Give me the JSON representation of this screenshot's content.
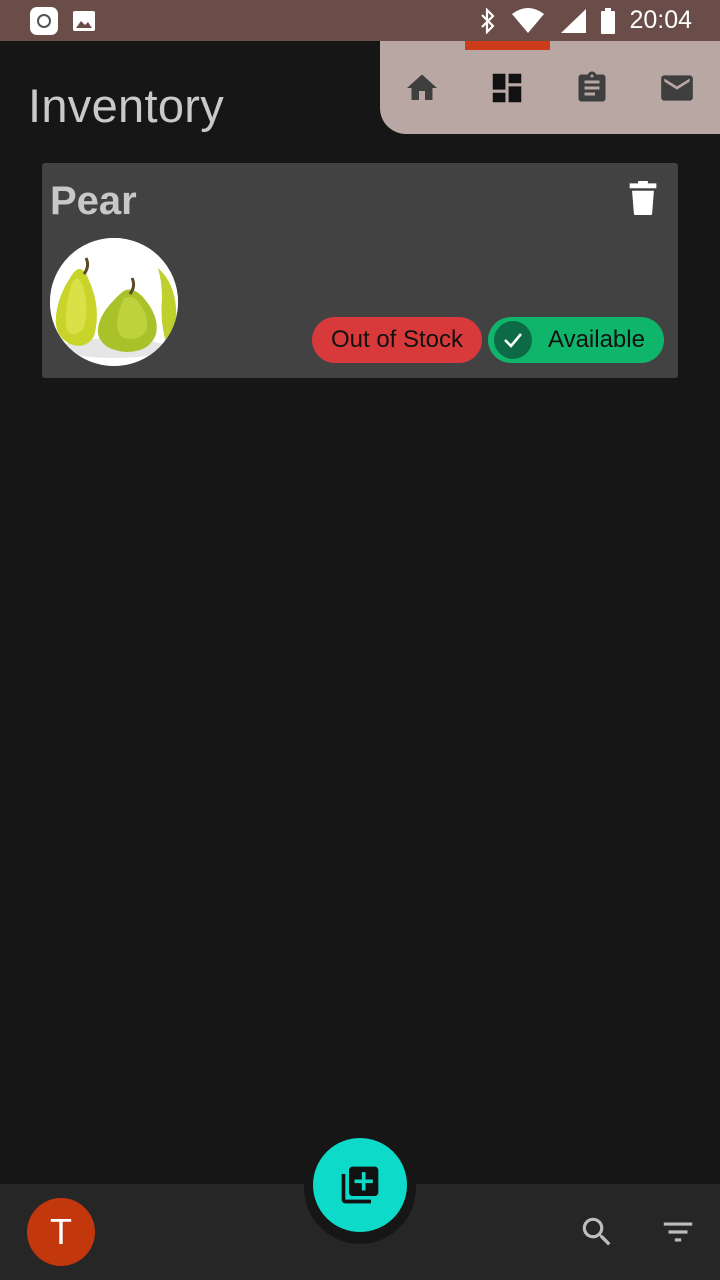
{
  "status_bar": {
    "time": "20:04",
    "icons": [
      "app-notification-icon",
      "image-notification-icon",
      "bluetooth-icon",
      "wifi-icon",
      "signal-icon",
      "battery-icon"
    ]
  },
  "page": {
    "title": "Inventory"
  },
  "top_nav": {
    "active_index": 1,
    "items": [
      {
        "icon": "home-icon"
      },
      {
        "icon": "dashboard-icon"
      },
      {
        "icon": "clipboard-icon"
      },
      {
        "icon": "mail-icon"
      }
    ],
    "indicator_color": "#cc3b1a",
    "background": "#b8a7a2"
  },
  "inventory": [
    {
      "name": "Pear",
      "image": "pear-image",
      "status_out": "Out of Stock",
      "status_available": "Available",
      "out_color": "#d83a3c",
      "available_color": "#0fb56a"
    }
  ],
  "bottom_bar": {
    "avatar_initial": "T",
    "avatar_color": "#c2380c",
    "fab_icon": "add-to-library-icon",
    "fab_color": "#0ddac8",
    "icons": [
      "search-icon",
      "filter-icon"
    ]
  }
}
